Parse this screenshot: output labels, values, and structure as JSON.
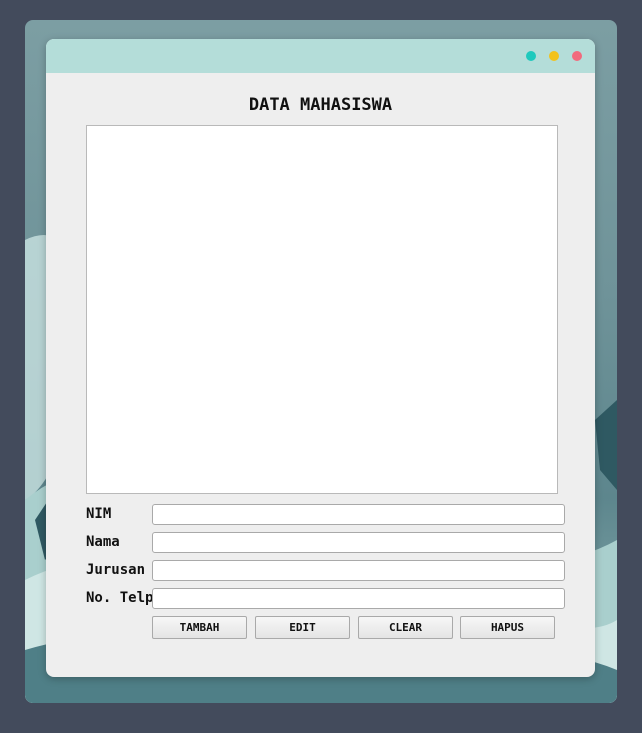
{
  "heading": "DATA MAHASISWA",
  "form": {
    "fields": [
      {
        "label": "NIM",
        "value": ""
      },
      {
        "label": "Nama",
        "value": ""
      },
      {
        "label": "Jurusan",
        "value": ""
      },
      {
        "label": "No. Telp",
        "value": ""
      }
    ]
  },
  "buttons": {
    "tambah": "TAMBAH",
    "edit": "EDIT",
    "clear": "CLEAR",
    "hapus": "HAPUS"
  },
  "colors": {
    "titlebar": "#b4ddd9",
    "dot_teal": "#1fc9bd",
    "dot_yellow": "#f2c21b",
    "dot_pink": "#f26a7d"
  }
}
